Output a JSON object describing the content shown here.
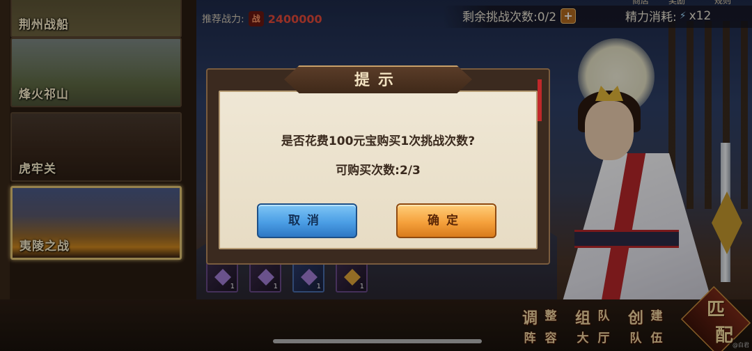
{
  "stages": [
    {
      "name": "荆州战船",
      "selected": false
    },
    {
      "name": "烽火祁山",
      "selected": false
    },
    {
      "name": "虎牢关",
      "selected": false
    },
    {
      "name": "夷陵之战",
      "selected": true
    }
  ],
  "hud": {
    "power_label": "推荐战力:",
    "power_badge": "战",
    "power_value": "2400000",
    "remaining_label": "剩余挑战次数:0/2",
    "plus": "+",
    "energy_label": "精力消耗:",
    "energy_value": "x12",
    "nav": {
      "shop": "商店",
      "reward": "奖励",
      "rules": "规则"
    }
  },
  "items": [
    {
      "count": "1",
      "type": "purple"
    },
    {
      "count": "1",
      "type": "purple"
    },
    {
      "count": "1",
      "type": "blue"
    },
    {
      "count": "1",
      "type": "gold"
    }
  ],
  "actions": {
    "adjust": [
      "调",
      "整",
      "阵",
      "容"
    ],
    "team": [
      "组",
      "队",
      "大",
      "厅"
    ],
    "create": [
      "创",
      "建",
      "队",
      "伍"
    ],
    "match": [
      "匹",
      "配"
    ]
  },
  "dialog": {
    "title": "提示",
    "message": "是否花费100元宝购买1次挑战次数?",
    "sub": "可购买次数:2/3",
    "cancel": "取消",
    "confirm": "确定"
  },
  "watermark": "@白君",
  "colors": {
    "power_value": "#e64a3a",
    "cancel": "#4b9ee5",
    "confirm": "#f5a13c"
  }
}
